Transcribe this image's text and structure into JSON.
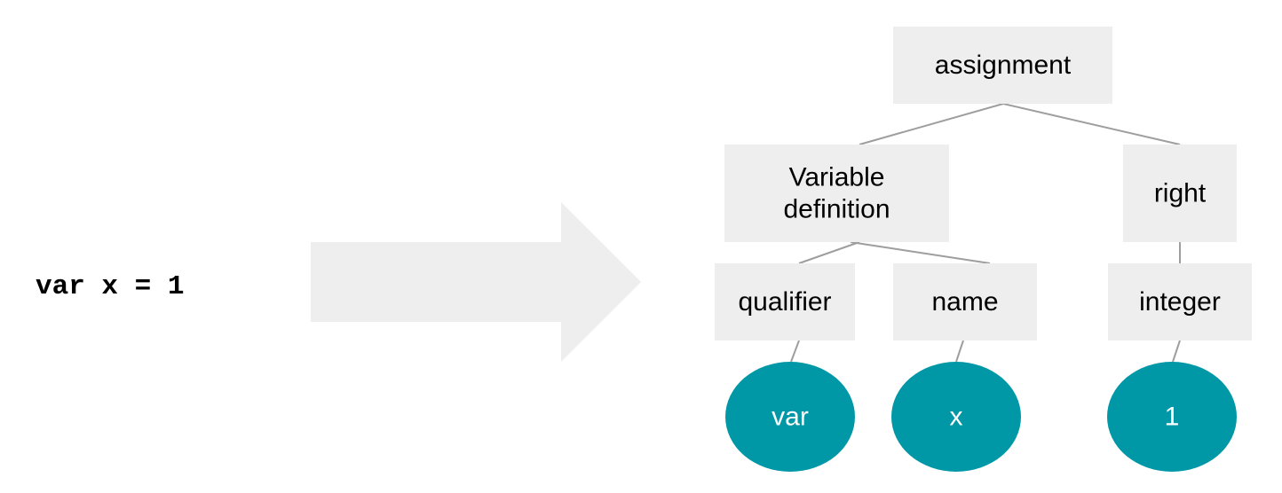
{
  "source_code": "var x = 1",
  "colors": {
    "node_fill": "#eeeeee",
    "leaf_fill": "#0098a6",
    "edge": "#9e9e9e",
    "arrow": "#eeeeee"
  },
  "tree": {
    "nodes": {
      "assignment": {
        "label": "assignment",
        "kind": "box"
      },
      "vardef": {
        "label": [
          "Variable",
          "definition"
        ],
        "kind": "box"
      },
      "right": {
        "label": "right",
        "kind": "box"
      },
      "qualifier": {
        "label": "qualifier",
        "kind": "box"
      },
      "name": {
        "label": "name",
        "kind": "box"
      },
      "integer": {
        "label": "integer",
        "kind": "box"
      },
      "leaf_var": {
        "label": "var",
        "kind": "leaf"
      },
      "leaf_x": {
        "label": "x",
        "kind": "leaf"
      },
      "leaf_1": {
        "label": "1",
        "kind": "leaf"
      }
    },
    "edges": [
      [
        "assignment",
        "vardef"
      ],
      [
        "assignment",
        "right"
      ],
      [
        "vardef",
        "qualifier"
      ],
      [
        "vardef",
        "name"
      ],
      [
        "right",
        "integer"
      ],
      [
        "qualifier",
        "leaf_var"
      ],
      [
        "name",
        "leaf_x"
      ],
      [
        "integer",
        "leaf_1"
      ]
    ]
  }
}
